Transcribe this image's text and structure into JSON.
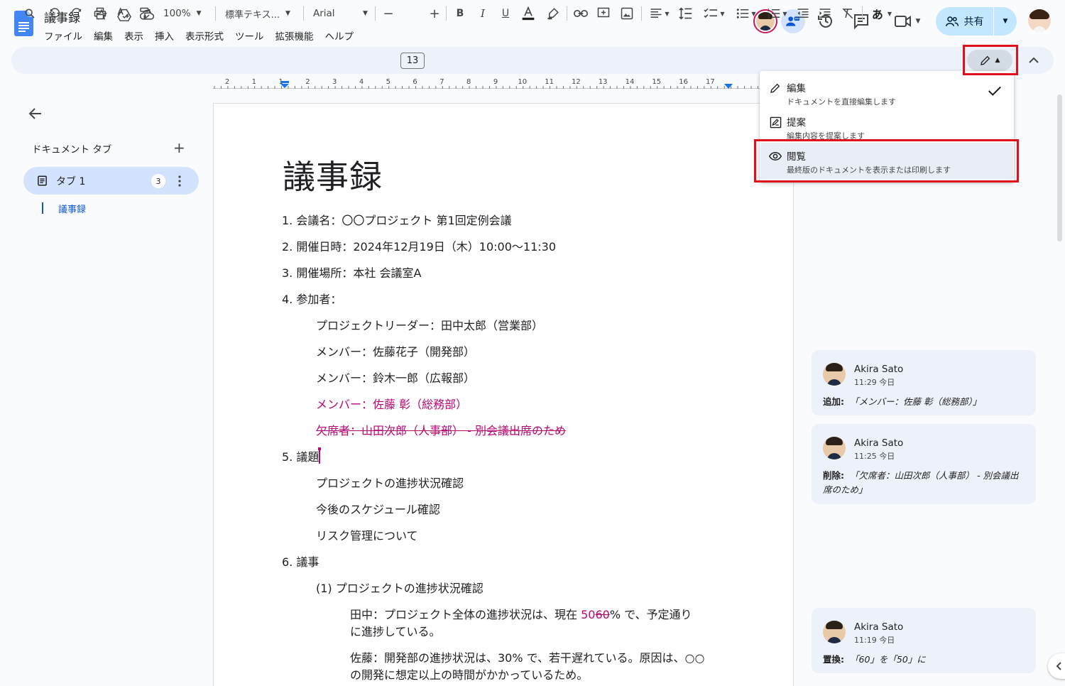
{
  "app": {
    "doc_title": "議事録",
    "menu": [
      "ファイル",
      "編集",
      "表示",
      "挿入",
      "表示形式",
      "ツール",
      "拡張機能",
      "ヘルプ"
    ],
    "share_label": "共有"
  },
  "toolbar": {
    "zoom": "100%",
    "style": "標準テキス...",
    "font": "Arial",
    "font_size": "13",
    "input_tool": "あ"
  },
  "ruler": [
    "2",
    "1",
    "1",
    "2",
    "3",
    "4",
    "5",
    "6",
    "7",
    "8",
    "9",
    "10",
    "11",
    "12",
    "13",
    "14",
    "15",
    "16",
    "17"
  ],
  "sidebar": {
    "header": "ドキュメント タブ",
    "tab_label": "タブ 1",
    "tab_count": "3",
    "outline_item": "議事録"
  },
  "mode_menu": {
    "items": [
      {
        "title": "編集",
        "desc": "ドキュメントを直接編集します"
      },
      {
        "title": "提案",
        "desc": "編集内容を提案します"
      },
      {
        "title": "閲覧",
        "desc": "最終版のドキュメントを表示または印刷します"
      }
    ]
  },
  "document": {
    "heading": "議事録",
    "l1": "1. 会議名：〇〇プロジェクト 第1回定例会議",
    "l2": "2. 開催日時：2024年12月19日（木）10:00〜11:30",
    "l3": "3. 開催場所：本社 会議室A",
    "l4": "4. 参加者：",
    "p1": "プロジェクトリーダー：田中太郎（営業部）",
    "p2": "メンバー：佐藤花子（開発部）",
    "p3": "メンバー：鈴木一郎（広報部）",
    "p4": "メンバー：佐藤 彰（総務部）",
    "p5": "欠席者：山田次郎（人事部） - 別会議出席のため",
    "l5": "5. 議題",
    "a1": "プロジェクトの進捗状況確認",
    "a2": "今後のスケジュール確認",
    "a3": "リスク管理について",
    "l6": "6. 議事",
    "s1": "(1) プロジェクトの進捗状況確認",
    "t1a": "田中：プロジェクト全体の進捗状況は、現在 ",
    "t1_ins": "50",
    "t1_del": "60",
    "t1b": "% で、予定通り",
    "t1c": "に進捗している。",
    "t2a": "佐藤：開発部の進捗状況は、30% で、若干遅れている。原因は、○○",
    "t2b": "の開発に想定以上の時間がかかっているため。"
  },
  "suggestions": [
    {
      "name": "Akira Sato",
      "time": "11:29 今日",
      "action": "追加:",
      "text": "「メンバー：佐藤 彰（総務部）」"
    },
    {
      "name": "Akira Sato",
      "time": "11:25 今日",
      "action": "削除:",
      "text": "「欠席者：山田次郎（人事部） - 別会議出席のため」"
    },
    {
      "name": "Akira Sato",
      "time": "11:19 今日",
      "action": "置換:",
      "text": "「60」を「50」に"
    }
  ],
  "colors": {
    "suggestion": "#b80672",
    "accent": "#0b57d0",
    "highlight": "#e0101a"
  }
}
